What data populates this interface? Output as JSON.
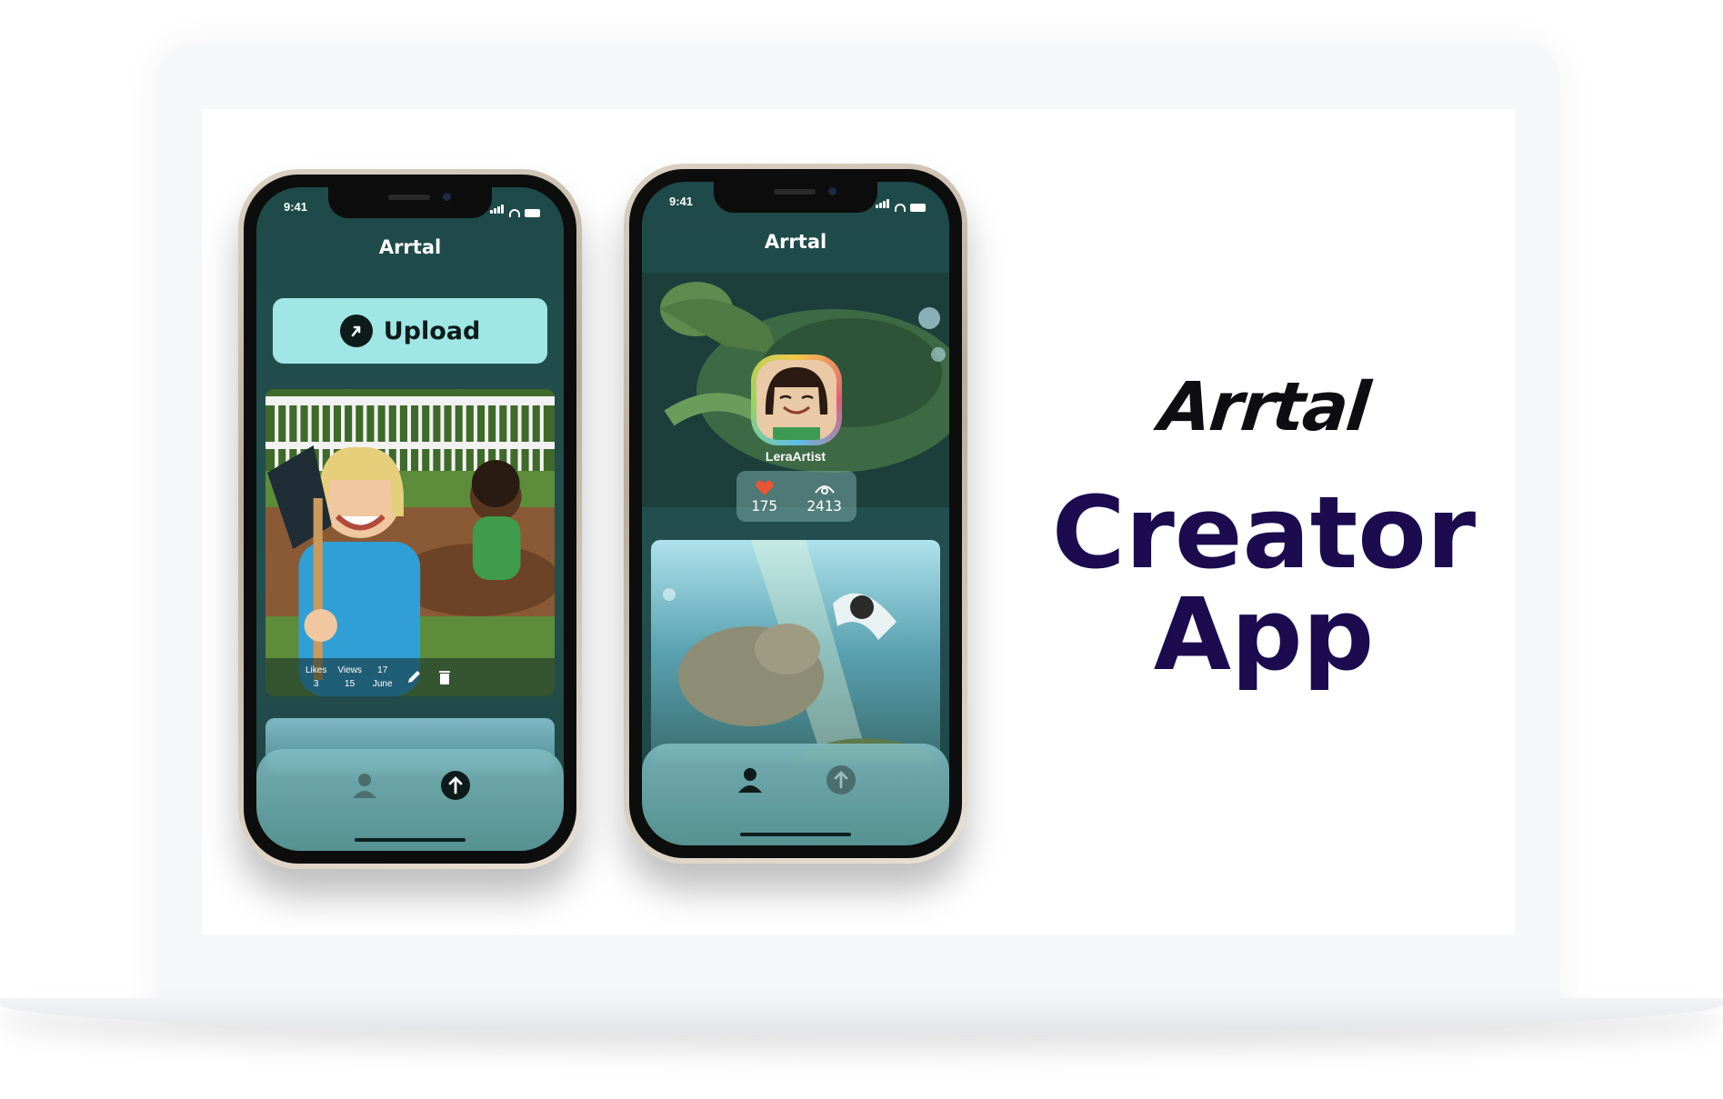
{
  "left_phone": {
    "status_time": "9:41",
    "app_title": "Arrtal",
    "upload_label": "Upload",
    "card": {
      "likes_label": "Likes",
      "likes_value": "3",
      "views_label": "Views",
      "views_value": "15",
      "date_day": "17",
      "date_month": "June"
    },
    "tabs": [
      {
        "icon": "profile-icon",
        "active": false
      },
      {
        "icon": "upload-icon",
        "active": true
      }
    ]
  },
  "right_phone": {
    "status_time": "9:41",
    "app_title": "Arrtal",
    "username": "LeraArtist",
    "likes_count": "175",
    "views_count": "2413",
    "tabs": [
      {
        "icon": "profile-icon",
        "active": true
      },
      {
        "icon": "upload-icon",
        "active": false
      }
    ]
  },
  "brand": {
    "name": "Arrtal",
    "subtitle_line1": "Creator",
    "subtitle_line2": "App",
    "name_color": "#0e0e12",
    "subtitle_color": "#1c0b4f",
    "accent_color": "#9fe6e4",
    "screen_bg": "#1f4a4a"
  }
}
